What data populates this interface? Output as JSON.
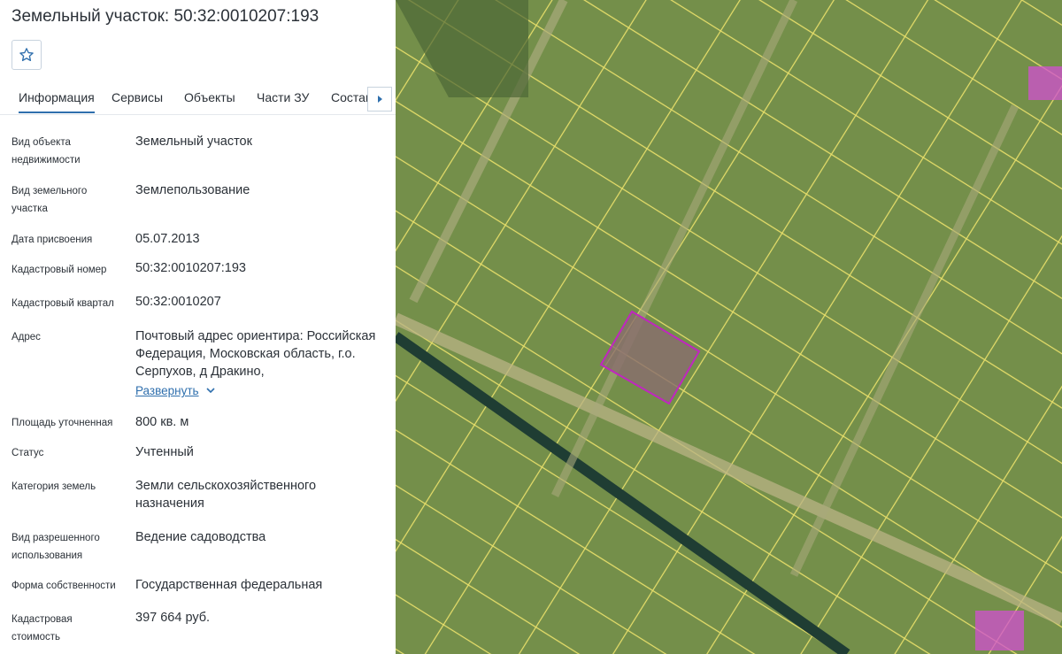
{
  "title": "Земельный участок: 50:32:0010207:193",
  "tabs": [
    "Информация",
    "Сервисы",
    "Объекты",
    "Части ЗУ",
    "Состав"
  ],
  "expand_label": "Развернуть",
  "rows": [
    {
      "label": "Вид объекта недвижимости",
      "value": "Земельный участок"
    },
    {
      "label": "Вид земельного участка",
      "value": "Землепользование"
    },
    {
      "label": "Дата присвоения",
      "value": "05.07.2013"
    },
    {
      "label": "Кадастровый номер",
      "value": "50:32:0010207:193"
    },
    {
      "label": "Кадастровый квартал",
      "value": "50:32:0010207"
    },
    {
      "label": "Адрес",
      "value": "Почтовый адрес ориентира: Российская Федерация, Московская область, г.о. Серпухов, д Дракино,"
    },
    {
      "label": "Площадь уточненная",
      "value": "800 кв. м"
    },
    {
      "label": "Статус",
      "value": "Учтенный"
    },
    {
      "label": "Категория земель",
      "value": "Земли сельскохозяйственного назначения"
    },
    {
      "label": "Вид разрешенного использования",
      "value": "Ведение садоводства"
    },
    {
      "label": "Форма собственности",
      "value": "Государственная федеральная"
    },
    {
      "label": "Кадастровая стоимость",
      "value": "397 664 руб."
    }
  ],
  "icons": {
    "favorite": "star-outline-icon",
    "tabs_scroll": "chevron-right-icon",
    "expand": "chevron-down-icon"
  },
  "colors": {
    "accent": "#2f6fad",
    "parcel_lines": "#e8df6a",
    "selected_parcel": "#b329b3",
    "satellite_green": "#6f8a45"
  }
}
